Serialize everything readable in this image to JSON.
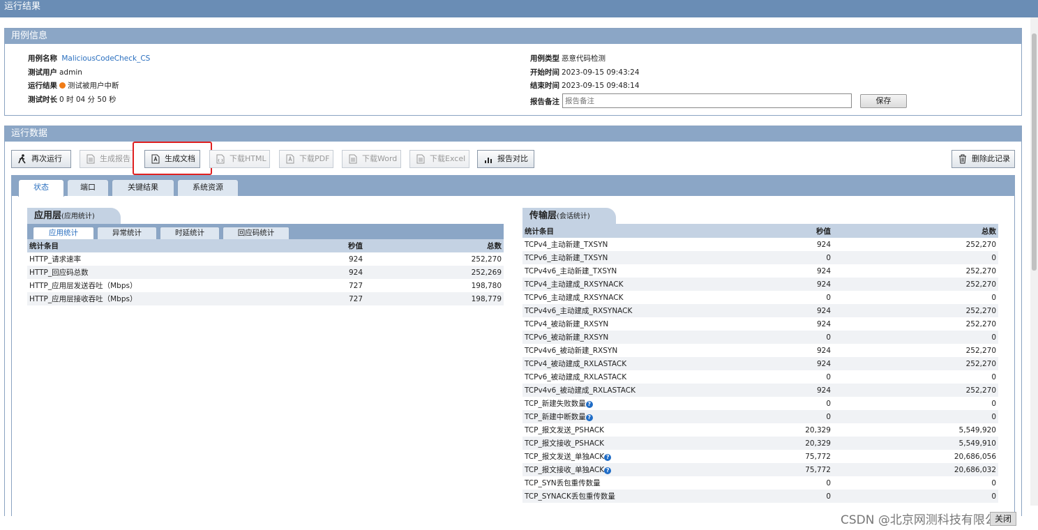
{
  "window_title": "运行结果",
  "case_info": {
    "header": "用例信息",
    "name_label": "用例名称",
    "name_value": "MaliciousCodeCheck_CS",
    "user_label": "测试用户",
    "user_value": "admin",
    "result_label": "运行结果",
    "result_value": "测试被用户中断",
    "result_color": "#f07b16",
    "duration_label": "测试时长",
    "duration_value": "0 时 04 分 50 秒",
    "type_label": "用例类型",
    "type_value": "恶意代码检测",
    "start_label": "开始时间",
    "start_value": "2023-09-15 09:43:24",
    "end_label": "结束时间",
    "end_value": "2023-09-15 09:48:14",
    "remark_label": "报告备注",
    "remark_placeholder": "报告备注",
    "save_label": "保存"
  },
  "run_data": {
    "header": "运行数据",
    "toolbar": {
      "rerun": "再次运行",
      "gen_report": "生成报告",
      "gen_doc": "生成文档",
      "download_html": "下载HTML",
      "download_pdf": "下载PDF",
      "download_word": "下载Word",
      "download_excel": "下载Excel",
      "compare": "报告对比",
      "delete": "删除此记录"
    },
    "tabs": [
      "状态",
      "端口",
      "关键结果",
      "系统资源"
    ],
    "active_tab": "状态"
  },
  "app_layer": {
    "title": "应用层",
    "subtitle": "(应用统计)",
    "subtabs": [
      "应用统计",
      "异常统计",
      "时延统计",
      "回应码统计"
    ],
    "columns": [
      "统计条目",
      "秒值",
      "总数"
    ],
    "rows": [
      [
        "HTTP_请求速率",
        "924",
        "252,270"
      ],
      [
        "HTTP_回应码总数",
        "924",
        "252,269"
      ],
      [
        "HTTP_应用层发送吞吐（Mbps）",
        "727",
        "198,780"
      ],
      [
        "HTTP_应用层接收吞吐（Mbps）",
        "727",
        "198,779"
      ]
    ]
  },
  "transport_layer": {
    "title": "传输层",
    "subtitle": "(会话统计)",
    "columns": [
      "统计条目",
      "秒值",
      "总数"
    ],
    "rows": [
      [
        "TCPv4_主动新建_TXSYN",
        "924",
        "252,270"
      ],
      [
        "TCPv6_主动新建_TXSYN",
        "0",
        "0"
      ],
      [
        "TCPv4v6_主动新建_TXSYN",
        "924",
        "252,270"
      ],
      [
        "TCPv4_主动建成_RXSYNACK",
        "924",
        "252,270"
      ],
      [
        "TCPv6_主动建成_RXSYNACK",
        "0",
        "0"
      ],
      [
        "TCPv4v6_主动建成_RXSYNACK",
        "924",
        "252,270"
      ],
      [
        "TCPv4_被动新建_RXSYN",
        "924",
        "252,270"
      ],
      [
        "TCPv6_被动新建_RXSYN",
        "0",
        "0"
      ],
      [
        "TCPv4v6_被动新建_RXSYN",
        "924",
        "252,270"
      ],
      [
        "TCPv4_被动建成_RXLASTACK",
        "924",
        "252,270"
      ],
      [
        "TCPv6_被动建成_RXLASTACK",
        "0",
        "0"
      ],
      [
        "TCPv4v6_被动建成_RXLASTACK",
        "924",
        "252,270"
      ],
      [
        "TCP_新建失败数量",
        "0",
        "0"
      ],
      [
        "TCP_新建中断数量",
        "0",
        "0"
      ],
      [
        "TCP_报文发送_PSHACK",
        "20,329",
        "5,549,920"
      ],
      [
        "TCP_报文接收_PSHACK",
        "20,329",
        "5,549,910"
      ],
      [
        "TCP_报文发送_单独ACK",
        "75,772",
        "20,686,056"
      ],
      [
        "TCP_报文接收_单独ACK",
        "75,772",
        "20,686,032"
      ],
      [
        "TCP_SYN丢包重传数量",
        "0",
        "0"
      ],
      [
        "TCP_SYNACK丢包重传数量",
        "0",
        "0"
      ]
    ],
    "help_rows": [
      12,
      13,
      16,
      17
    ]
  },
  "watermark": "CSDN @北京网测科技有限公司",
  "watermark_btn": "关闭"
}
